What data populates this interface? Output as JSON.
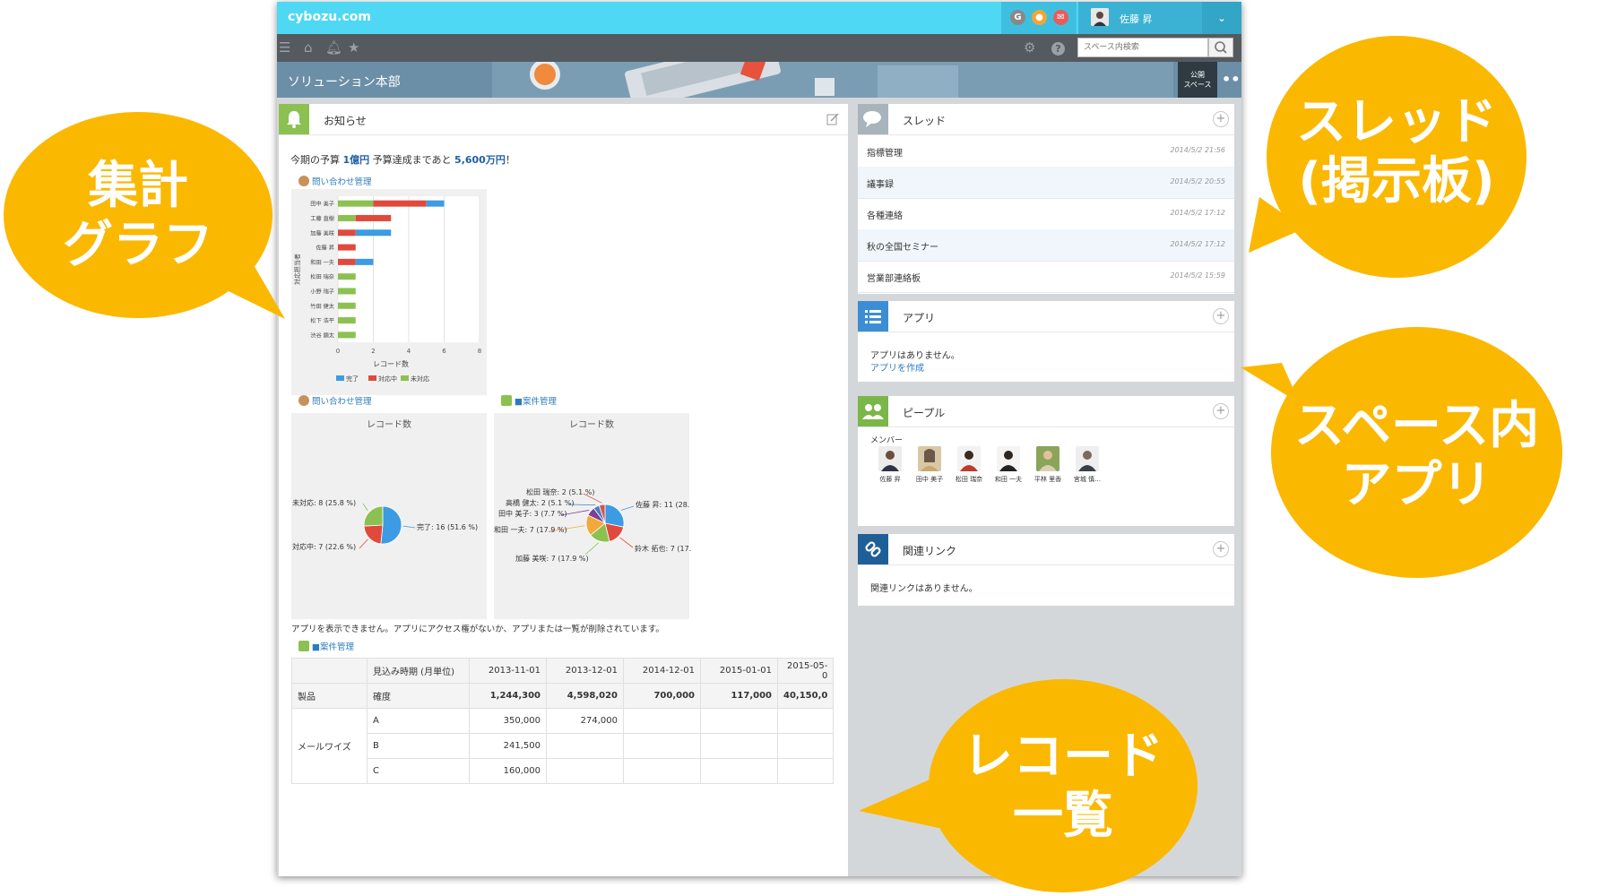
{
  "app": {
    "brand": "cybozu.com",
    "user_name": "佐藤 昇",
    "search_placeholder": "スペース内検索",
    "space_title": "ソリューション本部",
    "public_label_1": "公開",
    "public_label_2": "スペース"
  },
  "notice": {
    "title": "お知らせ",
    "budget_prefix": "今期の予算 ",
    "budget_value": "1億円",
    "budget_middle": " 予算達成まであと ",
    "budget_remaining": "5,600万円",
    "budget_suffix": "！",
    "app_label_inquiry": "問い合わせ管理",
    "app_label_project": "■案件管理",
    "no_app_message": "アプリを表示できません。アプリにアクセス権がないか、アプリまたは一覧が削除されています。"
  },
  "chart_data": [
    {
      "type": "bar",
      "orientation": "horizontal",
      "stacked": true,
      "categories": [
        "田中 美子",
        "工藤 直樹",
        "加藤 美咲",
        "佐藤 昇",
        "和田 一夫",
        "松田 瑞奈",
        "小野 瑞子",
        "竹田 健太",
        "松下 浩平",
        "渋谷 顕太"
      ],
      "series": [
        {
          "name": "完了",
          "color": "#3d9be3",
          "values": [
            1,
            0,
            2,
            0,
            1,
            0,
            0,
            0,
            0,
            0
          ]
        },
        {
          "name": "対応中",
          "color": "#e04a3d",
          "values": [
            3,
            2,
            1,
            1,
            1,
            0,
            0,
            0,
            0,
            0
          ]
        },
        {
          "name": "未対応",
          "color": "#8cc152",
          "values": [
            2,
            1,
            0,
            0,
            0,
            1,
            1,
            1,
            1,
            1
          ]
        }
      ],
      "xlabel": "レコード数",
      "ylabel": "対応担当者",
      "xlim": [
        0,
        8
      ],
      "xticks": [
        "0",
        "2",
        "4",
        "6",
        "8"
      ],
      "legend": "bottom"
    },
    {
      "type": "pie",
      "title": "レコード数",
      "slices": [
        {
          "label": "完了: 16 (51.6 %)",
          "value": 16,
          "color": "#3d9be3"
        },
        {
          "label": "対応中: 7 (22.6 %)",
          "value": 7,
          "color": "#e04a3d"
        },
        {
          "label": "未対応: 8 (25.8 %)",
          "value": 8,
          "color": "#8cc152"
        }
      ]
    },
    {
      "type": "pie",
      "title": "レコード数",
      "slices": [
        {
          "label": "佐藤 昇: 11 (28.",
          "value": 11,
          "color": "#3d9be3"
        },
        {
          "label": "鈴木 拓也: 7 (17.",
          "value": 7,
          "color": "#e04a3d"
        },
        {
          "label": "加藤 美咲: 7 (17.9 %)",
          "value": 7,
          "color": "#8cc152"
        },
        {
          "label": "和田 一夫: 7 (17.9 %)",
          "value": 7,
          "color": "#f2a93b"
        },
        {
          "label": "田中 美子: 3 (7.7 %)",
          "value": 3,
          "color": "#7b3f98"
        },
        {
          "label": "高橋 健太: 2 (5.1 %)",
          "value": 2,
          "color": "#4a7fc1"
        },
        {
          "label": "松田 瑞奈: 2 (5.1 %)",
          "value": 2,
          "color": "#d9534f"
        }
      ]
    }
  ],
  "table": {
    "header": [
      "",
      "見込み時期 (月単位)",
      "2013-11-01",
      "2013-12-01",
      "2014-12-01",
      "2015-01-01",
      "2015-05-0"
    ],
    "rows": [
      [
        "製品",
        "確度",
        "1,244,300",
        "4,598,020",
        "700,000",
        "117,000",
        "40,150,0"
      ],
      [
        "",
        "A",
        "350,000",
        "274,000",
        "",
        "",
        ""
      ],
      [
        "メールワイズ",
        "B",
        "241,500",
        "",
        "",
        "",
        ""
      ],
      [
        "",
        "C",
        "160,000",
        "",
        "",
        "",
        ""
      ]
    ]
  },
  "threads": {
    "title": "スレッド",
    "items": [
      {
        "name": "指標管理",
        "date": "2014/5/2 21:56"
      },
      {
        "name": "議事録",
        "date": "2014/5/2 20:55"
      },
      {
        "name": "各種連絡",
        "date": "2014/5/2 17:12"
      },
      {
        "name": "秋の全国セミナー",
        "date": "2014/5/2 17:12"
      },
      {
        "name": "営業部連絡板",
        "date": "2014/5/2 15:59"
      }
    ]
  },
  "apps": {
    "title": "アプリ",
    "empty": "アプリはありません。",
    "create": "アプリを作成"
  },
  "people": {
    "title": "ピープル",
    "members_label": "メンバー",
    "members": [
      "佐藤 昇",
      "田中 美子",
      "松田 瑞奈",
      "和田 一夫",
      "平林 里香",
      "宮城 慎…"
    ]
  },
  "links": {
    "title": "関連リンク",
    "empty": "関連リンクはありません。"
  },
  "callouts": {
    "graph_1": "集計",
    "graph_2": "グラフ",
    "thread_1": "スレッド",
    "thread_2": "(掲示板)",
    "app_1": "スペース内",
    "app_2": "アプリ",
    "record_1": "レコード",
    "record_2": "一覧"
  },
  "colors": {
    "callout": "#fbb800",
    "topbar": "#4ed8f4",
    "navbar": "#555a5e",
    "complete": "#3d9be3",
    "in_progress": "#e04a3d",
    "not_started": "#8cc152"
  }
}
